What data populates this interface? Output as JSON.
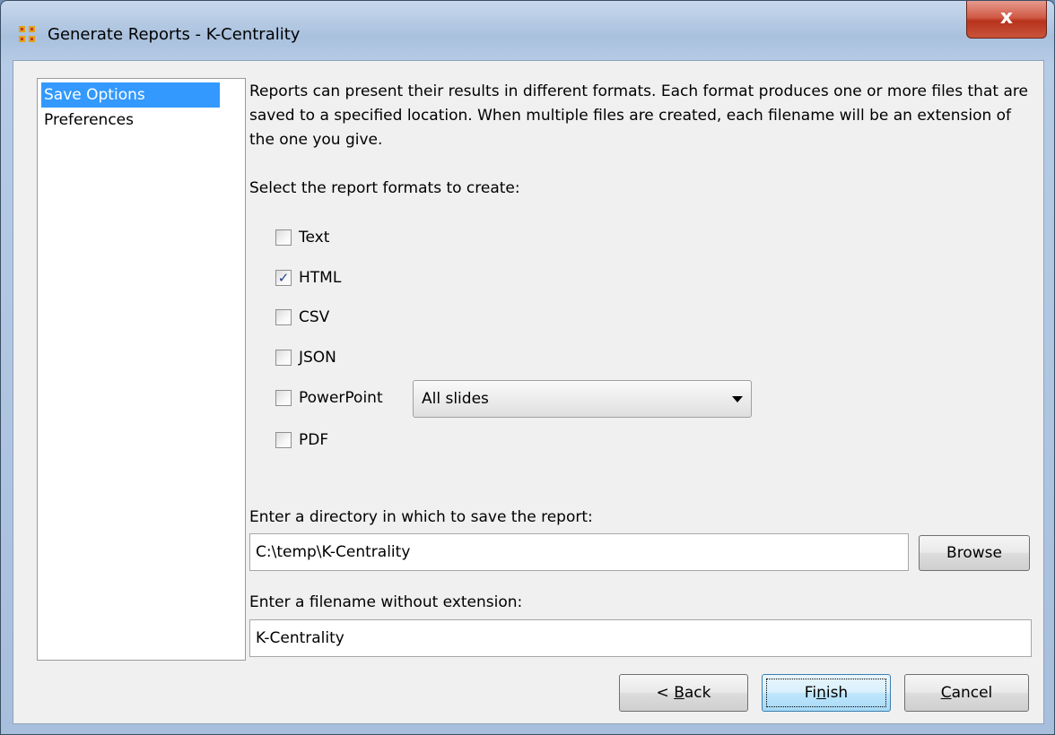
{
  "window": {
    "title": "Generate Reports - K-Centrality",
    "close_label": "x"
  },
  "nav": {
    "items": [
      {
        "label": "Save Options",
        "selected": true
      },
      {
        "label": "Preferences",
        "selected": false
      }
    ]
  },
  "main": {
    "description": "Reports can present their results in different formats. Each format produces one or more files that are saved to a specified location. When multiple files are created, each filename will be an extension of the one you give.",
    "formats_label": "Select the report formats to create:",
    "formats": [
      {
        "label": "Text",
        "checked": false
      },
      {
        "label": "HTML",
        "checked": true
      },
      {
        "label": "CSV",
        "checked": false
      },
      {
        "label": "JSON",
        "checked": false
      },
      {
        "label": "PowerPoint",
        "checked": false
      },
      {
        "label": "PDF",
        "checked": false
      }
    ],
    "powerpoint_option": "All slides",
    "directory_label": "Enter a directory in which to save the report:",
    "directory_value": "C:\\temp\\K-Centrality",
    "browse_label": "Browse",
    "filename_label": "Enter a filename without extension:",
    "filename_value": "K-Centrality"
  },
  "buttons": {
    "back_prefix": "< ",
    "back_mnemonic": "B",
    "back_rest": "ack",
    "finish_prefix": "Fi",
    "finish_mnemonic": "n",
    "finish_rest": "ish",
    "cancel_prefix": "",
    "cancel_mnemonic": "C",
    "cancel_rest": "ancel"
  },
  "colors": {
    "selection": "#3399ff",
    "check": "#23408e"
  }
}
